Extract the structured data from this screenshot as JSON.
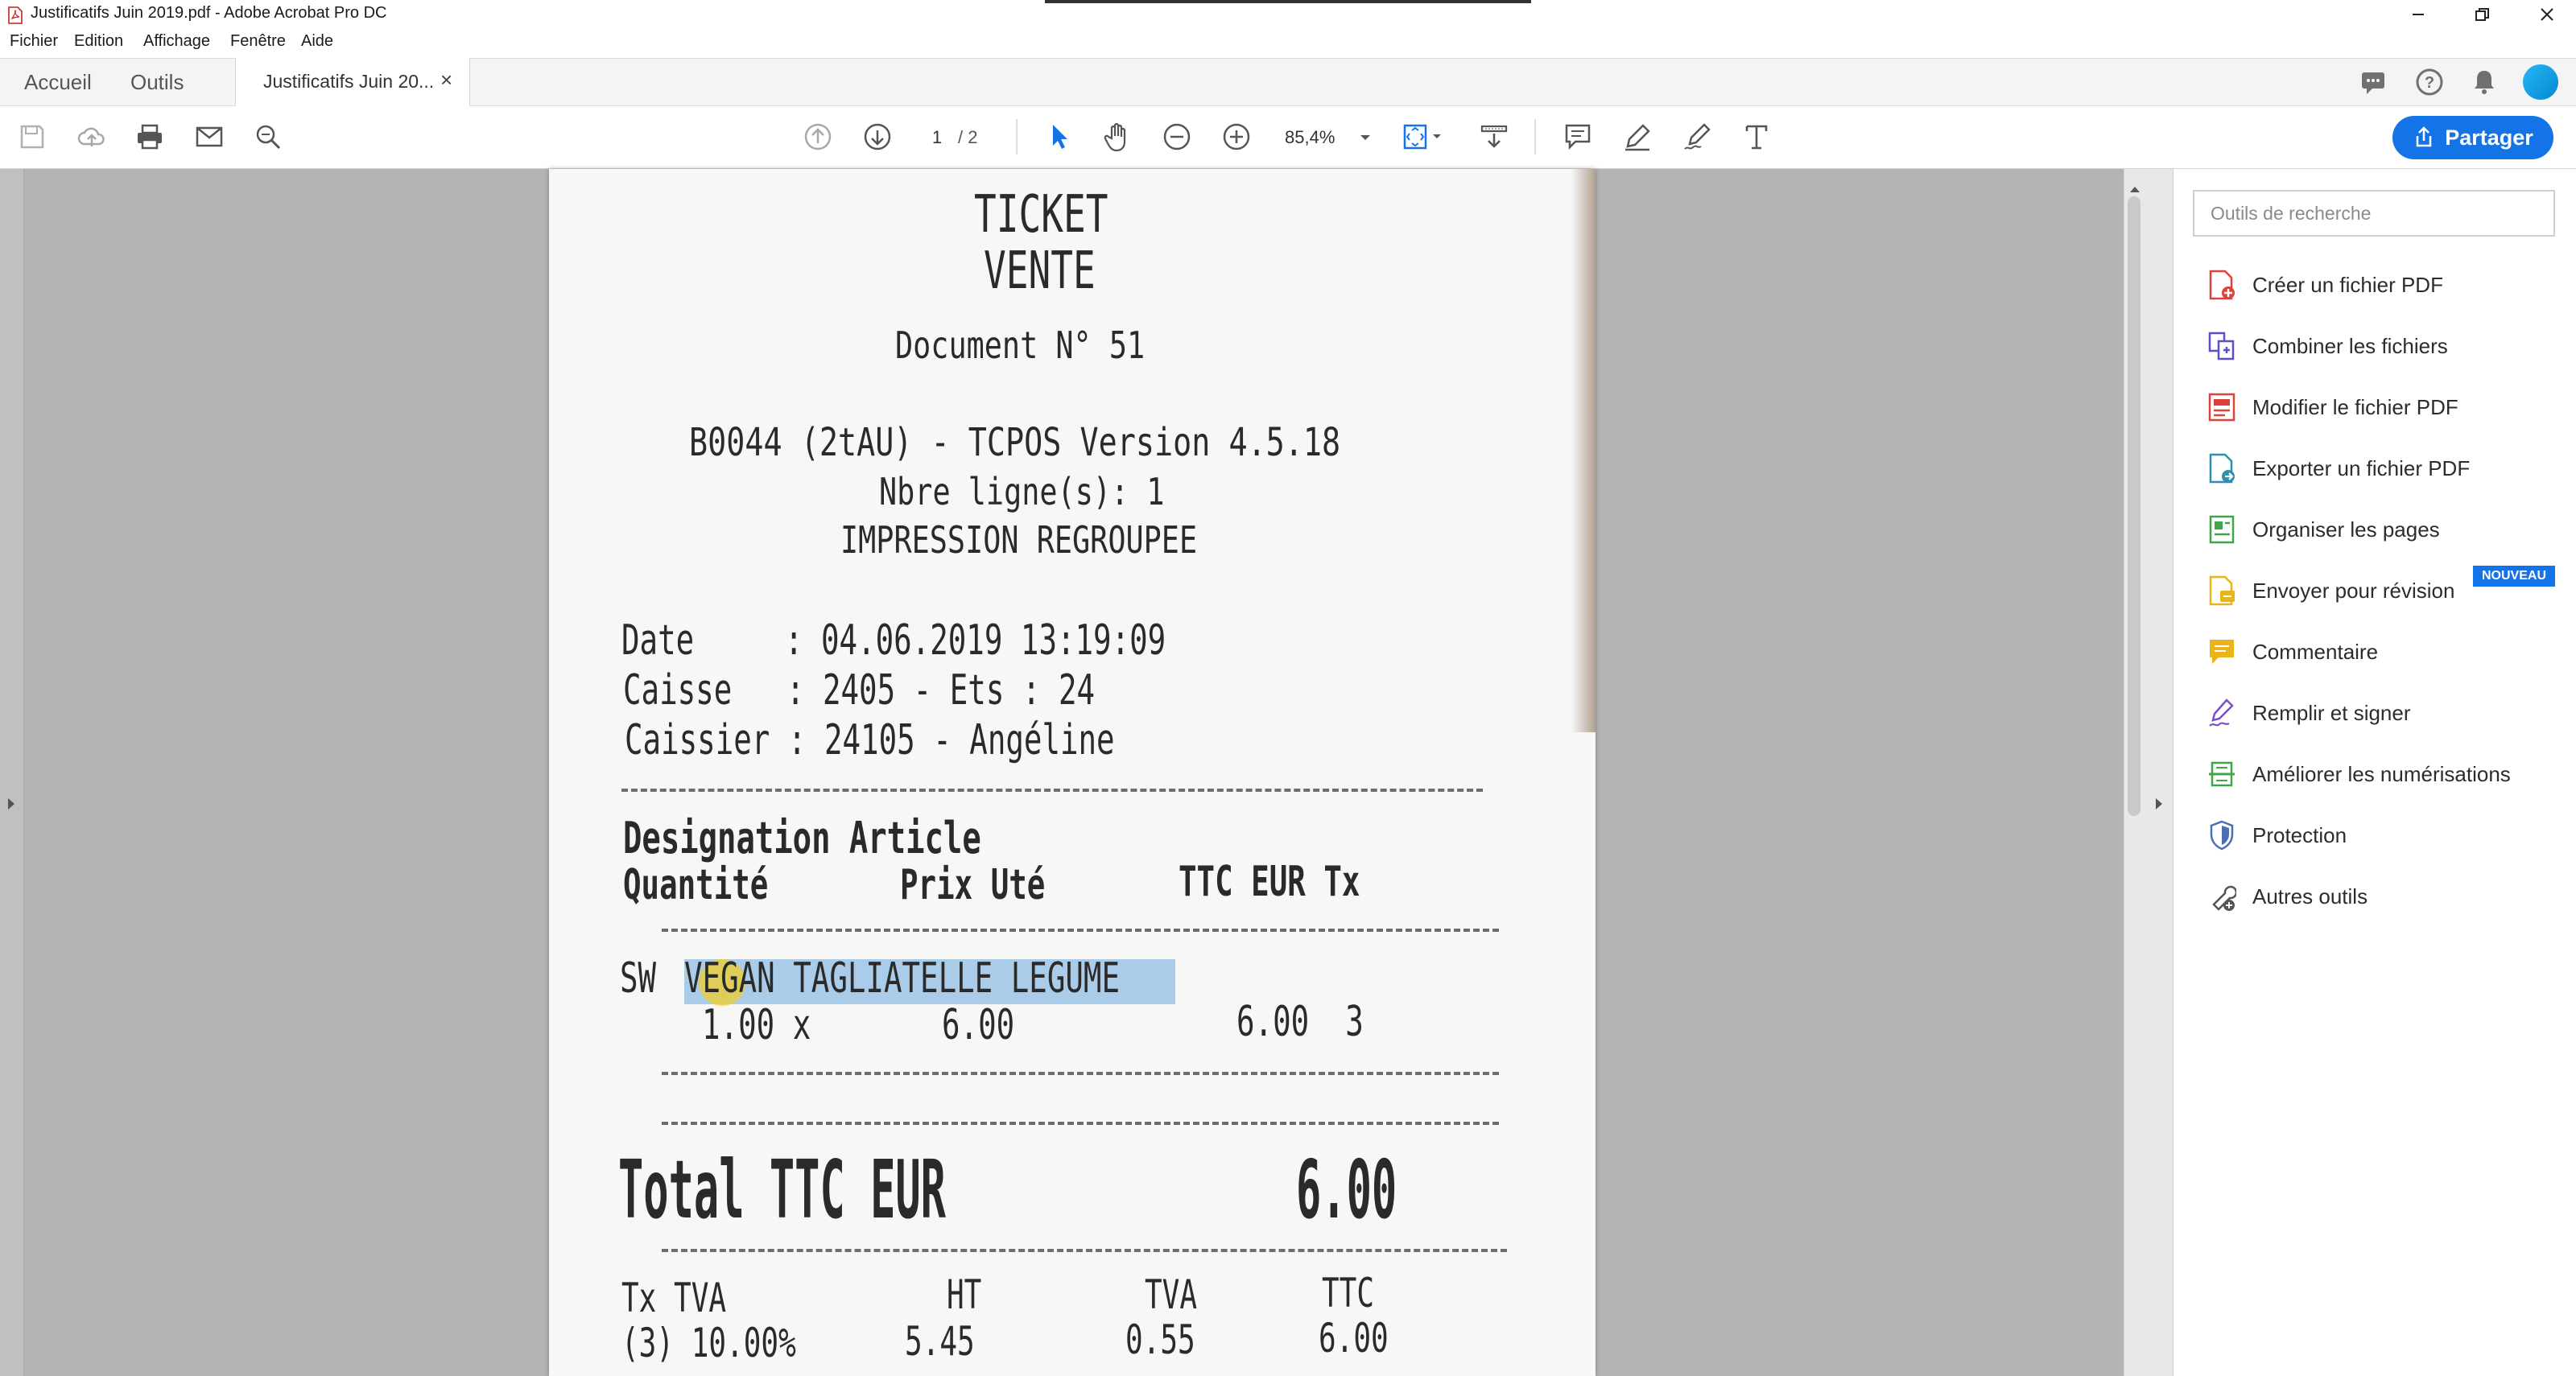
{
  "window": {
    "title": "Justificatifs Juin 2019.pdf - Adobe Acrobat Pro DC"
  },
  "menu": [
    "Fichier",
    "Edition",
    "Affichage",
    "Fenêtre",
    "Aide"
  ],
  "tabs": {
    "home": "Accueil",
    "tools": "Outils",
    "document": "Justificatifs Juin 20...",
    "close_glyph": "×"
  },
  "toolbar": {
    "page_current": "1",
    "page_total": "/ 2",
    "zoom": "85,4%",
    "share_label": "Partager"
  },
  "receipt": {
    "line1": "TICKET",
    "line2": "VENTE",
    "doc_no": "Document N° 51",
    "version": "B0044 (2tAU) - TCPOS Version 4.5.18",
    "lines": "Nbre ligne(s): 1",
    "impression": "IMPRESSION REGROUPEE",
    "date": "Date     : 04.06.2019 13:19:09",
    "caisse": "Caisse   : 2405 - Ets : 24",
    "caissier": "Caissier : 24105 - Angéline",
    "designation": "Designation Article",
    "col_qty": "Quantité",
    "col_price": "Prix Uté",
    "col_ttc": "TTC EUR Tx",
    "item_prefix": "SW",
    "item_name": "VEGAN TAGLIATELLE LEGUME",
    "item_qty": "1.00 x",
    "item_price": "6.00",
    "item_total": "6.00  3",
    "total_label": "Total TTC EUR",
    "total_value": "6.00",
    "vat_h_tx": "Tx TVA",
    "vat_h_ht": "HT",
    "vat_h_tva": "TVA",
    "vat_h_ttc": "TTC",
    "vat_tx": "(3) 10.00%",
    "vat_ht": "5.45",
    "vat_tva": "0.55",
    "vat_ttc": "6.00"
  },
  "right_panel": {
    "search_placeholder": "Outils de recherche",
    "badge_new": "NOUVEAU",
    "tools": [
      {
        "label": "Créer un fichier PDF",
        "icon": "create-pdf-icon",
        "color": "#e0403a"
      },
      {
        "label": "Combiner les fichiers",
        "icon": "combine-files-icon",
        "color": "#5b4fc8"
      },
      {
        "label": "Modifier le fichier PDF",
        "icon": "edit-pdf-icon",
        "color": "#e0403a"
      },
      {
        "label": "Exporter un fichier PDF",
        "icon": "export-pdf-icon",
        "color": "#2e8fb0"
      },
      {
        "label": "Organiser les pages",
        "icon": "organize-pages-icon",
        "color": "#3fa64c"
      },
      {
        "label": "Envoyer pour révision",
        "icon": "send-review-icon",
        "color": "#e8b417"
      },
      {
        "label": "Commentaire",
        "icon": "comment-icon",
        "color": "#e8b417"
      },
      {
        "label": "Remplir et signer",
        "icon": "fill-sign-icon",
        "color": "#7b4fc8"
      },
      {
        "label": "Améliorer les numérisations",
        "icon": "enhance-scans-icon",
        "color": "#3fa64c"
      },
      {
        "label": "Protection",
        "icon": "protect-icon",
        "color": "#4a6fb5"
      },
      {
        "label": "Autres outils",
        "icon": "more-tools-icon",
        "color": "#555555"
      }
    ]
  },
  "colors": {
    "accent": "#1473e6",
    "selection": "#9ec4e6"
  }
}
